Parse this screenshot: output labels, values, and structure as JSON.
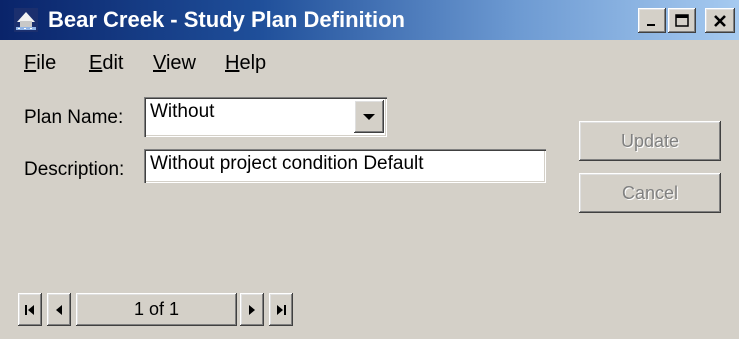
{
  "window": {
    "title": "Bear Creek - Study Plan Definition",
    "icon": "app-icon",
    "controls": {
      "minimize": "minimize-icon",
      "maximize": "maximize-icon",
      "close": "close-icon"
    }
  },
  "menu": {
    "items": [
      {
        "accel": "F",
        "rest": "ile"
      },
      {
        "accel": "E",
        "rest": "dit"
      },
      {
        "accel": "V",
        "rest": "iew"
      },
      {
        "accel": "H",
        "rest": "elp"
      }
    ]
  },
  "form": {
    "plan_name_label": "Plan Name:",
    "plan_name_value": "Without",
    "description_label": "Description:",
    "description_value": "Without project condition Default"
  },
  "buttons": {
    "update": "Update",
    "cancel": "Cancel"
  },
  "navigator": {
    "record_text": "1 of 1"
  },
  "colors": {
    "title_start": "#0a246a",
    "title_end": "#a6caf0",
    "face": "#d4d0c8"
  }
}
